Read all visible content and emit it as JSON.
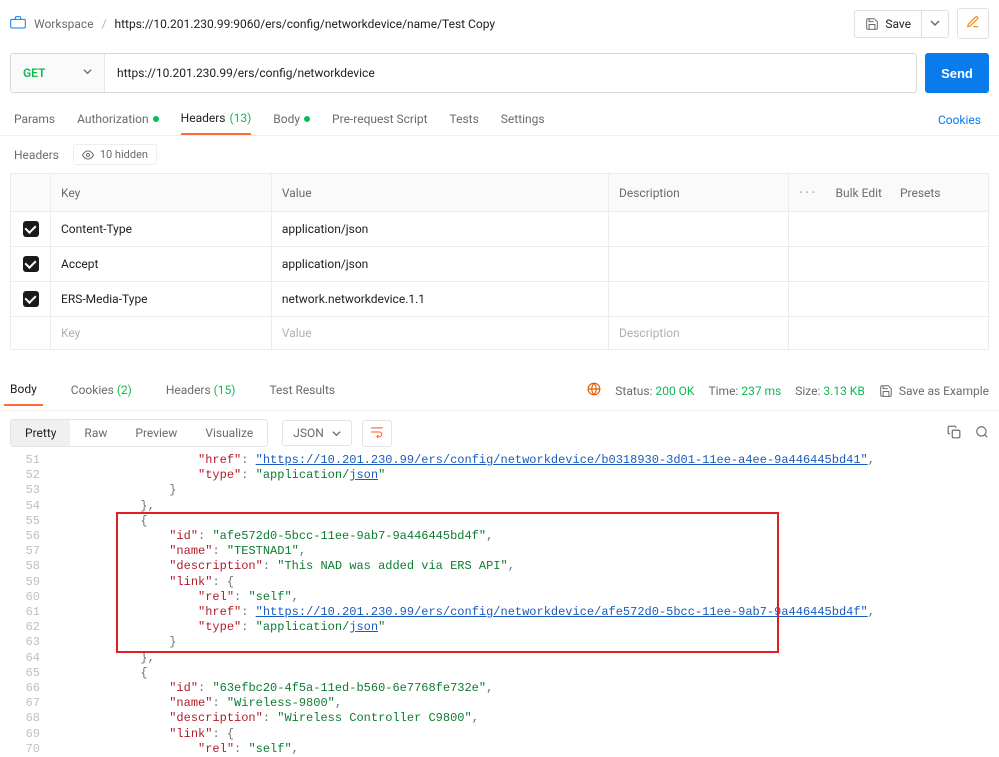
{
  "breadcrumb": {
    "workspace": "Workspace",
    "path": "https://10.201.230.99:9060/ers/config/networkdevice/name/Test Copy"
  },
  "topbar": {
    "save_label": "Save"
  },
  "request": {
    "method": "GET",
    "url": "https://10.201.230.99/ers/config/networkdevice",
    "send_label": "Send"
  },
  "req_tabs": {
    "params": "Params",
    "auth": "Authorization",
    "headers": "Headers",
    "headers_count": "(13)",
    "body": "Body",
    "prereq": "Pre-request Script",
    "tests": "Tests",
    "settings": "Settings",
    "cookies": "Cookies"
  },
  "headers_section": {
    "title": "Headers",
    "hidden_label": "10 hidden"
  },
  "kv_headers": {
    "th_key": "Key",
    "th_value": "Value",
    "th_desc": "Description",
    "bulk": "Bulk Edit",
    "presets": "Presets",
    "rows": [
      {
        "key": "Content-Type",
        "value": "application/json",
        "desc": ""
      },
      {
        "key": "Accept",
        "value": "application/json",
        "desc": ""
      },
      {
        "key": "ERS-Media-Type",
        "value": "network.networkdevice.1.1",
        "desc": ""
      }
    ],
    "ph_key": "Key",
    "ph_value": "Value",
    "ph_desc": "Description"
  },
  "resp_tabs": {
    "body": "Body",
    "cookies": "Cookies",
    "cookies_count": "(2)",
    "headers": "Headers",
    "headers_count": "(15)",
    "test_results": "Test Results"
  },
  "resp_meta": {
    "status_label": "Status:",
    "status_value": "200 OK",
    "time_label": "Time:",
    "time_value": "237 ms",
    "size_label": "Size:",
    "size_value": "3.13 KB",
    "save_example": "Save as Example"
  },
  "resp_subtabs": {
    "pretty": "Pretty",
    "raw": "Raw",
    "preview": "Preview",
    "visualize": "Visualize",
    "json": "JSON"
  },
  "code": {
    "lines": [
      {
        "n": "51",
        "html": "                    <span class='k'>\"href\"</span><span class='p'>: </span><span class='u'>\"https://10.201.230.99/ers/config/networkdevice/b0318930-3d01-11ee-a4ee-9a446445bd41\"</span><span class='p'>,</span>"
      },
      {
        "n": "52",
        "html": "                    <span class='k'>\"type\"</span><span class='p'>: </span><span class='s'>\"application/</span><span class='lnk'>json</span><span class='s'>\"</span>"
      },
      {
        "n": "53",
        "html": "                <span class='p'>}</span>"
      },
      {
        "n": "54",
        "html": "            <span class='p'>},</span>"
      },
      {
        "n": "55",
        "html": "            <span class='p'>{</span>"
      },
      {
        "n": "56",
        "html": "                <span class='k'>\"id\"</span><span class='p'>: </span><span class='s'>\"afe572d0-5bcc-11ee-9ab7-9a446445bd4f\"</span><span class='p'>,</span>"
      },
      {
        "n": "57",
        "html": "                <span class='k'>\"name\"</span><span class='p'>: </span><span class='s'>\"TESTNAD1\"</span><span class='p'>,</span>"
      },
      {
        "n": "58",
        "html": "                <span class='k'>\"description\"</span><span class='p'>: </span><span class='s'>\"This NAD was added via ERS API\"</span><span class='p'>,</span>"
      },
      {
        "n": "59",
        "html": "                <span class='k'>\"link\"</span><span class='p'>: {</span>"
      },
      {
        "n": "60",
        "html": "                    <span class='k'>\"rel\"</span><span class='p'>: </span><span class='s'>\"self\"</span><span class='p'>,</span>"
      },
      {
        "n": "61",
        "html": "                    <span class='k'>\"href\"</span><span class='p'>: </span><span class='u'>\"https://10.201.230.99/ers/config/networkdevice/afe572d0-5bcc-11ee-9ab7-9a446445bd4f\"</span><span class='p'>,</span>"
      },
      {
        "n": "62",
        "html": "                    <span class='k'>\"type\"</span><span class='p'>: </span><span class='s'>\"application/</span><span class='lnk'>json</span><span class='s'>\"</span>"
      },
      {
        "n": "63",
        "html": "                <span class='p'>}</span>"
      },
      {
        "n": "64",
        "html": "            <span class='p'>},</span>"
      },
      {
        "n": "65",
        "html": "            <span class='p'>{</span>"
      },
      {
        "n": "66",
        "html": "                <span class='k'>\"id\"</span><span class='p'>: </span><span class='s'>\"63efbc20-4f5a-11ed-b560-6e7768fe732e\"</span><span class='p'>,</span>"
      },
      {
        "n": "67",
        "html": "                <span class='k'>\"name\"</span><span class='p'>: </span><span class='s'>\"Wireless-9800\"</span><span class='p'>,</span>"
      },
      {
        "n": "68",
        "html": "                <span class='k'>\"description\"</span><span class='p'>: </span><span class='s'>\"Wireless Controller C9800\"</span><span class='p'>,</span>"
      },
      {
        "n": "69",
        "html": "                <span class='k'>\"link\"</span><span class='p'>: {</span>"
      },
      {
        "n": "70",
        "html": "                    <span class='k'>\"rel\"</span><span class='p'>: </span><span class='s'>\"self\"</span><span class='p'>,</span>"
      }
    ]
  },
  "highlight": {
    "top_line": "55",
    "bottom_line": "63"
  }
}
